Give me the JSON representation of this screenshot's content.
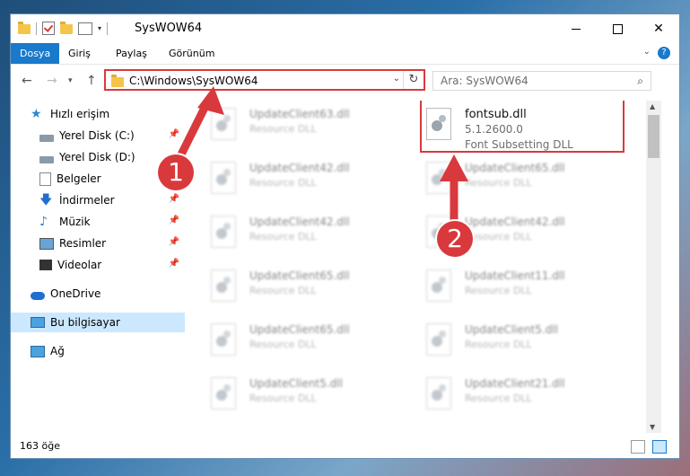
{
  "window": {
    "title": "SysWOW64",
    "controls": {
      "minimize": "—",
      "maximize": "☐",
      "close": "✕"
    }
  },
  "ribbon": {
    "tabs": [
      "Dosya",
      "Giriş",
      "Paylaş",
      "Görünüm"
    ],
    "active_tab": "Dosya",
    "help": "?"
  },
  "address": {
    "path": "C:\\Windows\\SysWOW64",
    "search_placeholder": "Ara: SysWOW64"
  },
  "sidebar": {
    "quick_access": "Hızlı erişim",
    "items": [
      {
        "label": "Yerel Disk (C:)",
        "icon": "disk-icon",
        "pinned": true
      },
      {
        "label": "Yerel Disk (D:)",
        "icon": "disk-icon",
        "pinned": false
      },
      {
        "label": "Belgeler",
        "icon": "docs-icon",
        "pinned": false
      },
      {
        "label": "İndirmeler",
        "icon": "download-icon",
        "pinned": true
      },
      {
        "label": "Müzik",
        "icon": "music-icon",
        "pinned": true
      },
      {
        "label": "Resimler",
        "icon": "pictures-icon",
        "pinned": true
      },
      {
        "label": "Videolar",
        "icon": "videos-icon",
        "pinned": true
      }
    ],
    "onedrive": "OneDrive",
    "this_pc": "Bu bilgisayar",
    "network": "Ağ"
  },
  "files": {
    "left_column": [
      {
        "name": "UpdateClient63.dll",
        "desc": "Resource DLL"
      },
      {
        "name": "UpdateClient42.dll",
        "desc": "Resource DLL"
      },
      {
        "name": "UpdateClient42.dll",
        "desc": "Resource DLL"
      },
      {
        "name": "UpdateClient65.dll",
        "desc": "Resource DLL"
      },
      {
        "name": "UpdateClient65.dll",
        "desc": "Resource DLL"
      },
      {
        "name": "UpdateClient5.dll",
        "desc": "Resource DLL"
      }
    ],
    "right_column": [
      {
        "name": "UpdateClient65.dll",
        "desc": "Resource DLL"
      },
      {
        "name": "UpdateClient42.dll",
        "desc": "Resource DLL"
      },
      {
        "name": "UpdateClient11.dll",
        "desc": "Resource DLL"
      },
      {
        "name": "UpdateClient5.dll",
        "desc": "Resource DLL"
      },
      {
        "name": "UpdateClient21.dll",
        "desc": "Resource DLL"
      }
    ],
    "highlighted": {
      "name": "fontsub.dll",
      "version": "5.1.2600.0",
      "desc": "Font Subsetting DLL"
    }
  },
  "status": {
    "count": "163 öğe"
  },
  "annotations": {
    "step1": "1",
    "step2": "2",
    "color": "#d9393c"
  }
}
